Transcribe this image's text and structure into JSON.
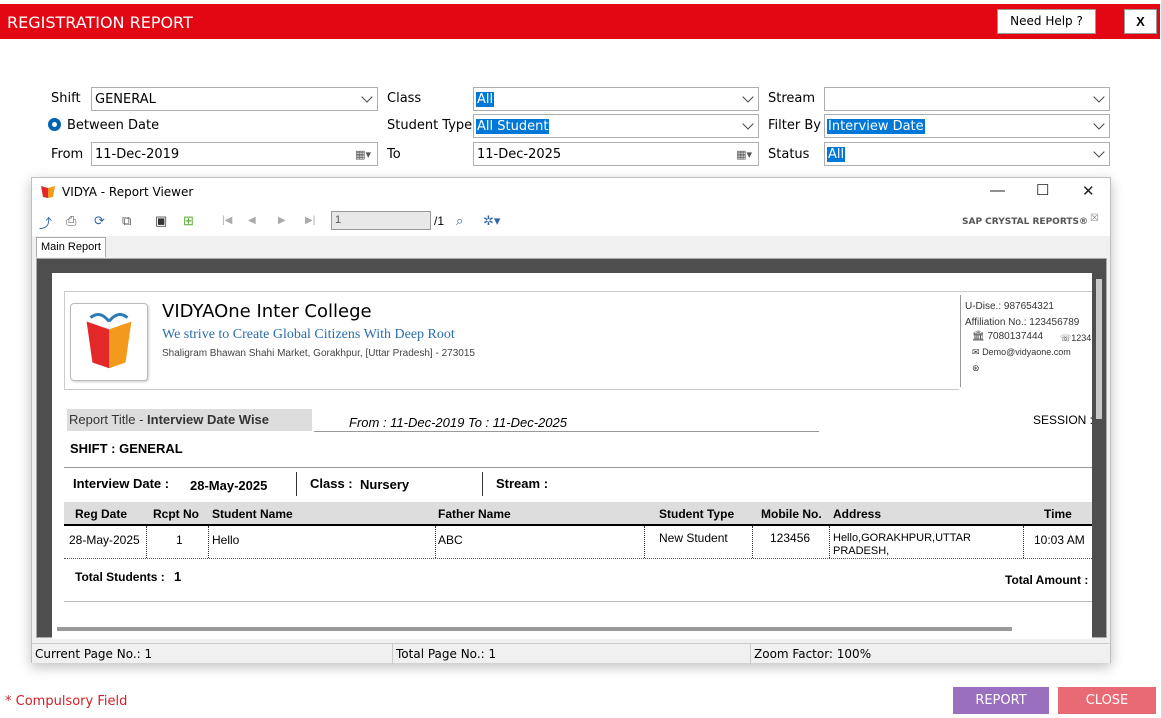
{
  "window": {
    "title": "REGISTRATION REPORT",
    "help_label": "Need Help ?",
    "close_label": "X"
  },
  "form": {
    "shift_label": "Shift",
    "shift_value": "GENERAL",
    "class_label": "Class",
    "class_value": "All",
    "stream_label": "Stream",
    "stream_value": "",
    "between_date_label": "Between Date",
    "student_type_label": "Student Type",
    "student_type_value": "All Student",
    "filter_by_label": "Filter By",
    "filter_by_value": "Interview Date",
    "from_label": "From",
    "from_value": "11-Dec-2019",
    "to_label": "To",
    "to_value": "11-Dec-2025",
    "status_label": "Status",
    "status_value": "All"
  },
  "viewer": {
    "title": "VIDYA - Report Viewer",
    "page_input": "1",
    "page_total": "/1",
    "brand": "SAP CRYSTAL REPORTS®",
    "tab_label": "Main Report",
    "status_current": "Current Page No.: 1",
    "status_total": "Total Page No.: 1",
    "status_zoom": "Zoom Factor: 100%"
  },
  "report": {
    "college_name": "VIDYAOne Inter College",
    "tagline": "We strive to Create Global Citizens With Deep Root",
    "address": "Shaligram Bhawan Shahi Market, Gorakhpur, [Uttar Pradesh] - 273015",
    "udise": "U-Dise.: 987654321",
    "affiliation": "Affiliation No.: 123456789",
    "phone": "7080137444",
    "phone2": "1234",
    "email": "Demo@vidyaone.com",
    "report_title_prefix": "Report Title - ",
    "report_title": "Interview Date Wise",
    "date_range": "From : 11-Dec-2019 To : 11-Dec-2025",
    "session_label": "SESSION :",
    "shift_line": "SHIFT  :  GENERAL",
    "interview_date_label": "Interview Date  :",
    "interview_date_value": "28-May-2025",
    "class_label": "Class  :",
    "class_value": "Nursery",
    "stream_label": "Stream  :",
    "columns": [
      "Reg Date",
      "Rcpt No",
      "Student Name",
      "Father Name",
      "Student Type",
      "Mobile No.",
      "Address",
      "Time"
    ],
    "rows": [
      {
        "reg_date": "28-May-2025",
        "rcpt_no": "1",
        "student_name": "Hello",
        "father_name": "ABC",
        "student_type": "New Student",
        "mobile": "123456",
        "address_line1": "Hello,GORAKHPUR,UTTAR",
        "address_line2": "PRADESH,",
        "time": "10:03 AM"
      }
    ],
    "total_students_label": "Total Students  :",
    "total_students_value": "1",
    "total_amount_label": "Total Amount :"
  },
  "footer": {
    "compulsory": "* Compulsory Field",
    "report_button": "REPORT",
    "close_button": "CLOSE"
  },
  "colors": {
    "accent": "#e30613",
    "report_button": "#9b6fbf",
    "close_button": "#e86a74",
    "selection": "#0078d7"
  }
}
